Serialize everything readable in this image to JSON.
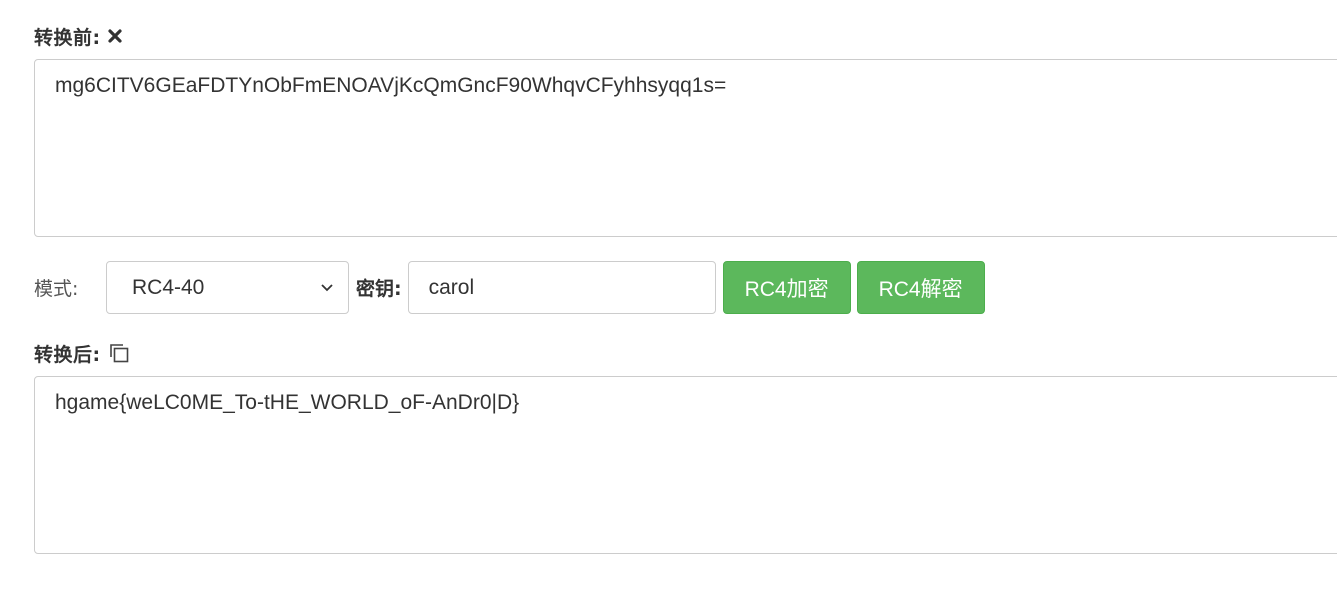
{
  "before": {
    "label": "转换前:",
    "clear_icon": "close-icon",
    "text": "mg6CITV6GEaFDTYnObFmENOAVjKcQmGncF90WhqvCFyhhsyqq1s="
  },
  "controls": {
    "mode_label": "模式:",
    "mode_selected": "RC4-40",
    "key_label": "密钥:",
    "key_value": "carol",
    "encrypt_label": "RC4加密",
    "decrypt_label": "RC4解密"
  },
  "after": {
    "label": "转换后:",
    "copy_icon": "copy-icon",
    "text": "hgame{weLC0ME_To-tHE_WORLD_oF-AnDr0|D}"
  },
  "colors": {
    "button_green": "#5cb85c",
    "border_gray": "#cccccc",
    "text_dark": "#333333"
  }
}
